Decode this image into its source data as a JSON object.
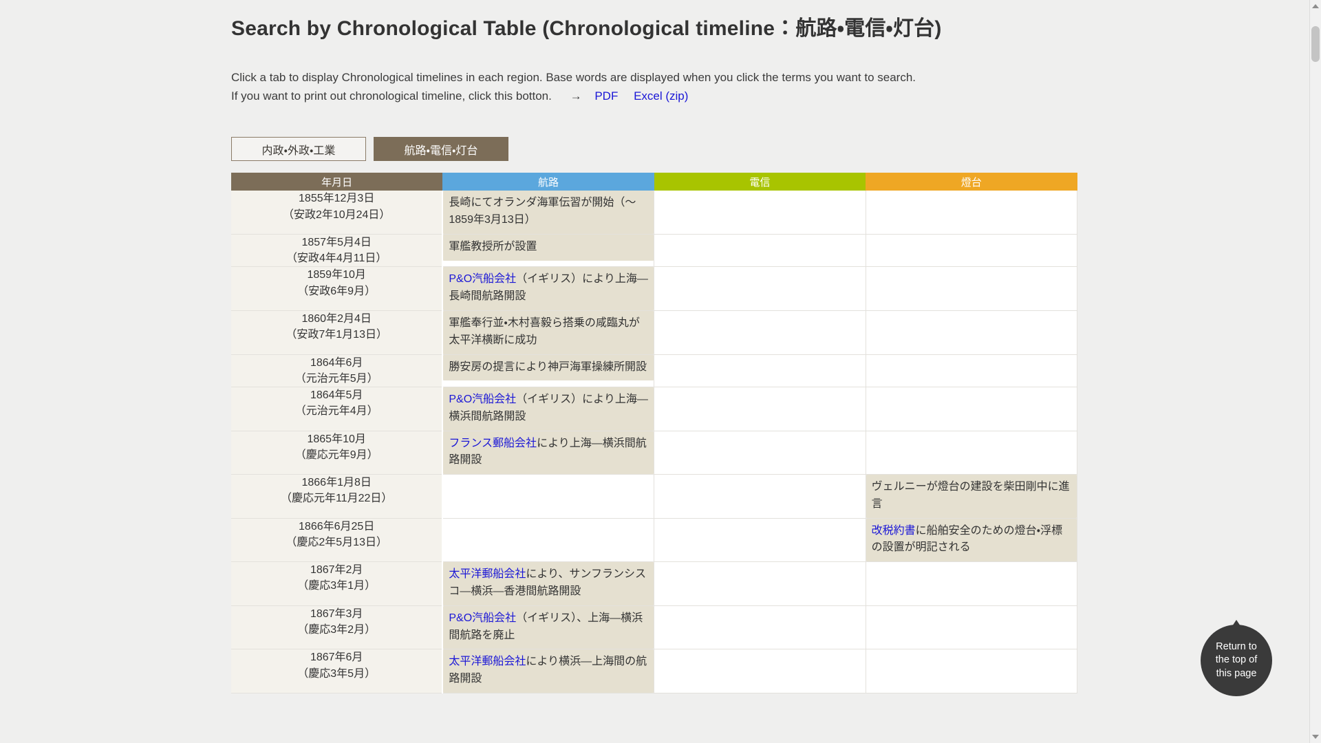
{
  "header": {
    "title": "Search by Chronological Table (Chronological timeline：航路・電信・灯台)"
  },
  "intro": {
    "line1": "Click a tab to display Chronological timelines in each region. Base words are displayed when you click the terms you want to search.",
    "line2": "If you want to print out chronological timeline, click this botton.",
    "arrow": "→",
    "pdf_label": "PDF",
    "excel_label": "Excel (zip)"
  },
  "tabs": [
    {
      "label": "内政・外政・工業",
      "active": false
    },
    {
      "label": "航路・電信・灯台",
      "active": true
    }
  ],
  "table": {
    "columns": [
      {
        "key": "date",
        "label": "年月日",
        "color": "#7c6d58"
      },
      {
        "key": "route",
        "label": "航路",
        "color": "#5ba7dd"
      },
      {
        "key": "telegraph",
        "label": "電信",
        "color": "#a8c400"
      },
      {
        "key": "lighthouse",
        "label": "燈台",
        "color": "#efa724"
      }
    ],
    "rows": [
      {
        "date": "1855年12月3日\n（安政2年10月24日）",
        "route": [
          {
            "text": "長崎にてオランダ海軍伝習が開始（～1859年3月13日）",
            "link": false
          }
        ],
        "telegraph": [],
        "lighthouse": []
      },
      {
        "date": "1857年5月4日\n（安政4年4月11日）",
        "route": [
          {
            "text": "軍艦教授所が設置",
            "link": false
          }
        ],
        "telegraph": [],
        "lighthouse": []
      },
      {
        "date": "1859年10月\n（安政6年9月）",
        "route": [
          {
            "text": "P&O汽船会社",
            "link": true
          },
          {
            "text": "（イギリス）により上海—長崎間航路開設",
            "link": false
          }
        ],
        "telegraph": [],
        "lighthouse": []
      },
      {
        "date": "1860年2月4日\n（安政7年1月13日）",
        "route": [
          {
            "text": "軍艦奉行並・木村喜毅ら搭乗の咸臨丸が太平洋横断に成功",
            "link": false
          }
        ],
        "telegraph": [],
        "lighthouse": []
      },
      {
        "date": "1864年6月\n（元治元年5月）",
        "route": [
          {
            "text": "勝安房の提言により神戸海軍操練所開設",
            "link": false
          }
        ],
        "telegraph": [],
        "lighthouse": []
      },
      {
        "date": "1864年5月\n（元治元年4月）",
        "route": [
          {
            "text": "P&O汽船会社",
            "link": true
          },
          {
            "text": "（イギリス）により上海—横浜間航路開設",
            "link": false
          }
        ],
        "telegraph": [],
        "lighthouse": []
      },
      {
        "date": "1865年10月\n（慶応元年9月）",
        "route": [
          {
            "text": "フランス郵船会社",
            "link": true
          },
          {
            "text": "により上海—横浜間航路開設",
            "link": false
          }
        ],
        "telegraph": [],
        "lighthouse": []
      },
      {
        "date": "1866年1月8日\n（慶応元年11月22日）",
        "route": [],
        "telegraph": [],
        "lighthouse": [
          {
            "text": "ヴェルニーが燈台の建設を柴田剛中に進言",
            "link": false
          }
        ]
      },
      {
        "date": "1866年6月25日\n（慶応2年5月13日）",
        "route": [],
        "telegraph": [],
        "lighthouse": [
          {
            "text": "改税約書",
            "link": true
          },
          {
            "text": "に船舶安全のための燈台・浮標の設置が明記される",
            "link": false
          }
        ]
      },
      {
        "date": "1867年2月\n（慶応3年1月）",
        "route": [
          {
            "text": "太平洋郵船会社",
            "link": true
          },
          {
            "text": "により、サンフランシスコ—横浜—香港間航路開設",
            "link": false
          }
        ],
        "telegraph": [],
        "lighthouse": []
      },
      {
        "date": "1867年3月\n（慶応3年2月）",
        "route": [
          {
            "text": "P&O汽船会社",
            "link": true
          },
          {
            "text": "（イギリス）、上海—横浜間航路を廃止",
            "link": false
          }
        ],
        "telegraph": [],
        "lighthouse": []
      },
      {
        "date": "1867年6月\n（慶応3年5月）",
        "route": [
          {
            "text": "太平洋郵船会社",
            "link": true
          },
          {
            "text": "により横浜—上海間の航路開設",
            "link": false
          }
        ],
        "telegraph": [],
        "lighthouse": []
      }
    ]
  },
  "to_top": {
    "label": "Return to\nthe top of\nthis page"
  }
}
